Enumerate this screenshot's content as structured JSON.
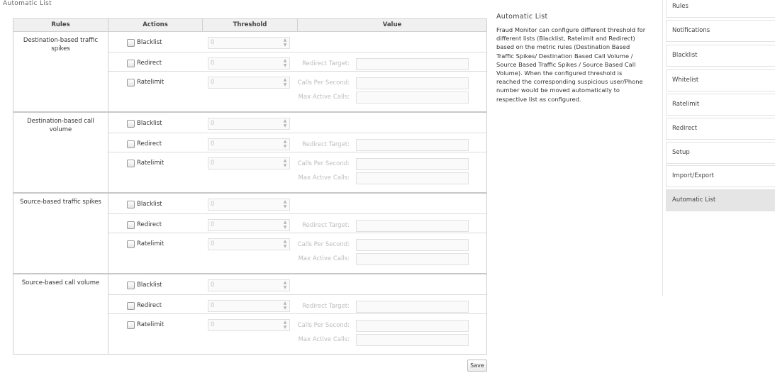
{
  "page": {
    "title": "Automatic List"
  },
  "table": {
    "headers": {
      "rules": "Rules",
      "actions": "Actions",
      "threshold": "Threshold",
      "value": "Value"
    },
    "groups": [
      {
        "rule": "Destination-based traffic spikes",
        "rows": [
          {
            "action": "Blacklist",
            "threshold": "0"
          },
          {
            "action": "Redirect",
            "threshold": "0",
            "value_labels": [
              "Redirect Target:"
            ]
          },
          {
            "action": "Ratelimit",
            "threshold": "0",
            "value_labels": [
              "Calls Per Second:",
              "Max Active Calls:"
            ]
          }
        ]
      },
      {
        "rule": "Destination-based call volume",
        "rows": [
          {
            "action": "Blacklist",
            "threshold": "0"
          },
          {
            "action": "Redirect",
            "threshold": "0",
            "value_labels": [
              "Redirect Target:"
            ]
          },
          {
            "action": "Ratelimit",
            "threshold": "0",
            "value_labels": [
              "Calls Per Second:",
              "Max Active Calls:"
            ]
          }
        ]
      },
      {
        "rule": "Source-based traffic spikes",
        "rows": [
          {
            "action": "Blacklist",
            "threshold": "0"
          },
          {
            "action": "Redirect",
            "threshold": "0",
            "value_labels": [
              "Redirect Target:"
            ]
          },
          {
            "action": "Ratelimit",
            "threshold": "0",
            "value_labels": [
              "Calls Per Second:",
              "Max Active Calls:"
            ]
          }
        ]
      },
      {
        "rule": "Source-based call volume",
        "rows": [
          {
            "action": "Blacklist",
            "threshold": "0"
          },
          {
            "action": "Redirect",
            "threshold": "0",
            "value_labels": [
              "Redirect Target:"
            ]
          },
          {
            "action": "Ratelimit",
            "threshold": "0",
            "value_labels": [
              "Calls Per Second:",
              "Max Active Calls:"
            ]
          }
        ]
      }
    ],
    "save_label": "Save"
  },
  "help": {
    "title": "Automatic List",
    "body": "Fraud Monitor can configure different threshold for different lists (Blacklist, Ratelimit and Redirect) based on the metric rules (Destination Based Traffic Spikes/ Destination Based Call Volume / Source Based Traffic Spikes / Source Based Call Volume). When the configured threshold is reached the corresponding suspicious user/Phone number would be moved automatically to respective list as configured."
  },
  "sidebar": {
    "items": [
      {
        "label": "Rules"
      },
      {
        "label": "Notifications"
      },
      {
        "label": "Blacklist"
      },
      {
        "label": "Whitelist"
      },
      {
        "label": "Ratelimit"
      },
      {
        "label": "Redirect"
      },
      {
        "label": "Setup"
      },
      {
        "label": "Import/Export"
      },
      {
        "label": "Automatic List"
      }
    ],
    "active_index": 8
  },
  "icons": {
    "checkbox": "checkbox-icon",
    "spinner": "spinner-arrows-icon"
  }
}
